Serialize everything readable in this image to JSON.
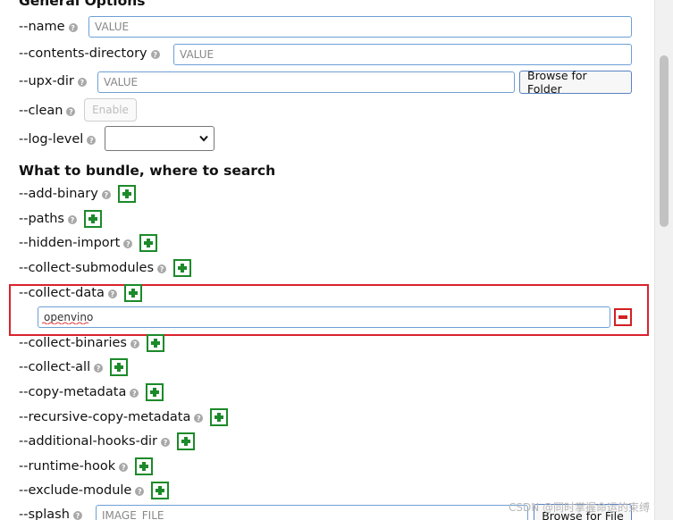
{
  "general_options": {
    "title": "General Options",
    "name_label": "--name",
    "name_placeholder": "VALUE",
    "contents_directory_label": "--contents-directory",
    "contents_directory_placeholder": "VALUE",
    "upx_dir_label": "--upx-dir",
    "upx_dir_placeholder": "VALUE",
    "browse_folder_label": "Browse for Folder",
    "clean_label": "--clean",
    "enable_label": "Enable",
    "log_level_label": "--log-level",
    "log_level_value": ""
  },
  "bundle": {
    "title": "What to bundle, where to search",
    "add_binary_label": "--add-binary",
    "paths_label": "--paths",
    "hidden_import_label": "--hidden-import",
    "collect_submodules_label": "--collect-submodules",
    "collect_data_label": "--collect-data",
    "collect_data_value": "openvino",
    "collect_binaries_label": "--collect-binaries",
    "collect_all_label": "--collect-all",
    "copy_metadata_label": "--copy-metadata",
    "recursive_copy_metadata_label": "--recursive-copy-metadata",
    "additional_hooks_dir_label": "--additional-hooks-dir",
    "runtime_hook_label": "--runtime-hook",
    "exclude_module_label": "--exclude-module",
    "splash_label": "--splash",
    "splash_placeholder": "IMAGE_FILE",
    "browse_file_label": "Browse for File"
  },
  "help_glyph": "?",
  "watermark": "CSDN @同时掌握命运的束缚",
  "colors": {
    "accent_green": "#1c8a2a",
    "remove_red": "#d32020",
    "highlight_red": "#d9232d",
    "input_border": "#6e9fd6"
  },
  "icons": {
    "help": "question-mark-circle-icon",
    "add": "plus-square-icon",
    "remove": "minus-square-icon",
    "dropdown": "chevron-down-icon"
  }
}
